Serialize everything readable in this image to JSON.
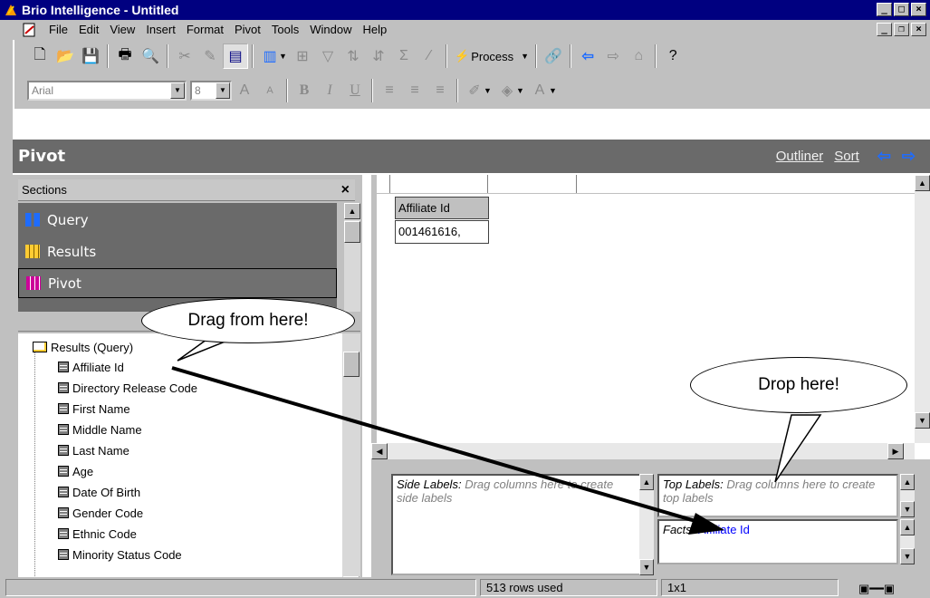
{
  "window": {
    "title": "Brio Intelligence - Untitled"
  },
  "menu": {
    "items": [
      "File",
      "Edit",
      "View",
      "Insert",
      "Format",
      "Pivot",
      "Tools",
      "Window",
      "Help"
    ]
  },
  "toolbar": {
    "process_label": "Process",
    "font_name": "Arial",
    "font_size": "8",
    "bold": "B",
    "italic": "I",
    "underline": "U"
  },
  "pivot_header": {
    "title": "Pivot",
    "outliner_link": "Outliner",
    "sort_link": "Sort"
  },
  "sections": {
    "title": "Sections",
    "close": "×",
    "items": [
      {
        "label": "Query",
        "icon": "query-icon",
        "color": "#1e6cff"
      },
      {
        "label": "Results",
        "icon": "results-icon",
        "color": "#ffcc33"
      },
      {
        "label": "Pivot",
        "icon": "pivot-icon",
        "color": "#cc0099",
        "selected": true
      }
    ]
  },
  "tree": {
    "root": "Results (Query)",
    "fields": [
      "Affiliate Id",
      "Directory Release Code",
      "First Name",
      "Middle Name",
      "Last Name",
      "Age",
      "Date Of Birth",
      "Gender Code",
      "Ethnic Code",
      "Minority Status Code"
    ]
  },
  "grid": {
    "column_header": "Affiliate Id",
    "cell_value": "001461616,"
  },
  "drop_panes": {
    "side_labels_title": "Side Labels:",
    "side_labels_hint": "Drag columns here to create side labels",
    "top_labels_title": "Top Labels:",
    "top_labels_hint": "Drag columns here to create top labels",
    "facts_title": "Facts:",
    "facts_value": "Affiliate Id"
  },
  "status": {
    "rows_used": "513 rows used",
    "grid_size": "1x1"
  },
  "callouts": {
    "drag_text": "Drag from here!",
    "drop_text": "Drop here!"
  },
  "colors": {
    "title_bar": "#000080",
    "section_bg": "#6a6a6a",
    "link_arrow": "#1e6cff",
    "facts_field": "#0000ff"
  }
}
